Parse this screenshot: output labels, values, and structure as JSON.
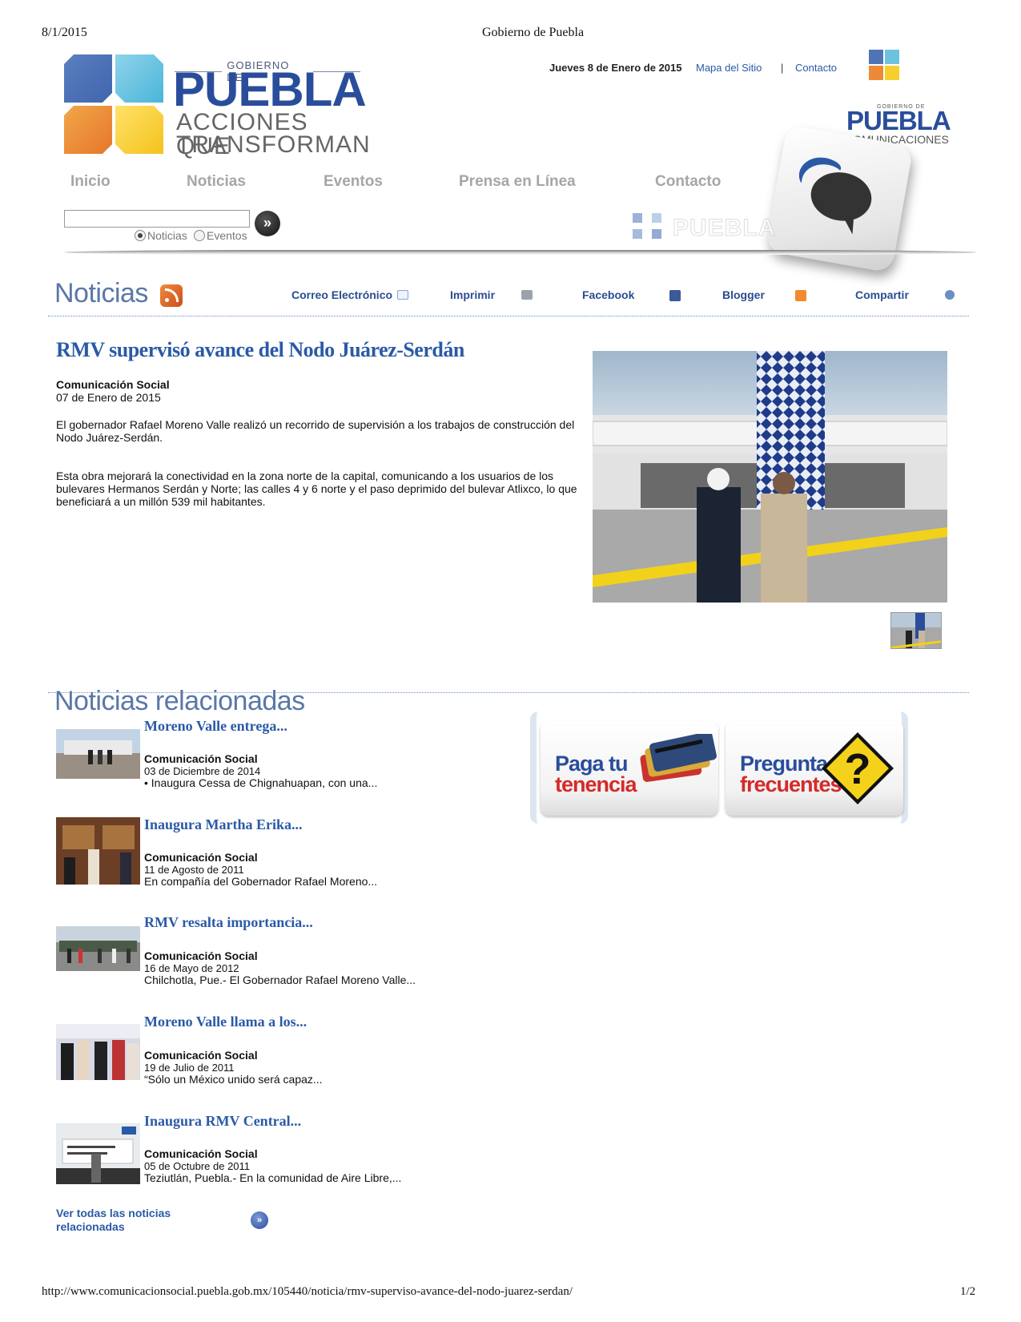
{
  "print_header": {
    "date": "8/1/2015",
    "title": "Gobierno de Puebla"
  },
  "print_footer": {
    "url": "http://www.comunicacionsocial.puebla.gob.mx/105440/noticia/rmv-superviso-avance-del-nodo-juarez-serdan/",
    "page": "1/2"
  },
  "logo": {
    "gobierno": "GOBIERNO DE",
    "puebla": "PUEBLA",
    "line1": "ACCIONES QUE",
    "line2": "TRANSFORMAN"
  },
  "top": {
    "date": "Jueves 8 de Enero de 2015",
    "sitemap": "Mapa del Sitio",
    "separator": "|",
    "contact": "Contacto"
  },
  "right_logo": {
    "gobierno": "GOBIERNO DE",
    "puebla": "PUEBLA",
    "sub": "COMUNICACIONES"
  },
  "nav": [
    "Inicio",
    "Noticias",
    "Eventos",
    "Prensa en Línea",
    "Contacto"
  ],
  "search": {
    "value": "",
    "radio_noticias": "Noticias",
    "radio_eventos": "Eventos",
    "selected": "Noticias",
    "button_glyph": "»"
  },
  "mini_logo": "PUEBLA",
  "section": {
    "title": "Noticias",
    "share": [
      "Correo Electrónico",
      "Imprimir",
      "Facebook",
      "Blogger",
      "Compartir"
    ]
  },
  "article": {
    "title": "RMV supervisó avance del Nodo Juárez-Serdán",
    "author": "Comunicación Social",
    "date": "07 de Enero de 2015",
    "para1_l1": "El gobernador Rafael Moreno Valle realizó un recorrido de supervisión a los trabajos de construcción del",
    "para1_l2": "Nodo Juárez-Serdán.",
    "para2_l1": "Esta obra mejorará la conectividad en la zona norte de la capital, comunicando a los usuarios de los",
    "para2_l2": "bulevares Hermanos Serdán y Norte; las calles 4 y 6 norte y el paso deprimido del bulevar Atlixco, lo que",
    "para2_l3": "beneficiará a un millón 539 mil habitantes."
  },
  "related": {
    "title": "Noticias relacionadas",
    "items": [
      {
        "title": "Moreno Valle entrega...",
        "author": "Comunicación Social",
        "date": "03 de Diciembre de 2014",
        "snippet": "• Inaugura Cessa de Chignahuapan, con una..."
      },
      {
        "title": "Inaugura Martha Erika...",
        "author": "Comunicación Social",
        "date": "11 de Agosto de 2011",
        "snippet": "En compañía del Gobernador Rafael Moreno..."
      },
      {
        "title": "RMV resalta importancia...",
        "author": "Comunicación Social",
        "date": "16 de Mayo de 2012",
        "snippet": "Chilchotla, Pue.- El Gobernador Rafael Moreno Valle..."
      },
      {
        "title": "Moreno Valle llama a los...",
        "author": "Comunicación Social",
        "date": "19 de Julio de 2011",
        "snippet": "“Sólo un México unido será capaz..."
      },
      {
        "title": "Inaugura RMV Central...",
        "author": "Comunicación Social",
        "date": "05 de Octubre de 2011",
        "snippet": "Teziutlán, Puebla.- En la comunidad de Aire Libre,..."
      }
    ],
    "see_all": "Ver todas las noticias relacionadas",
    "see_all_glyph": "»"
  },
  "promos": {
    "tenencia": {
      "line1": "Paga tu",
      "line2": "tenencia"
    },
    "preguntas": {
      "line1": "Preguntas",
      "line2": "frecuentes",
      "glyph": "?"
    }
  },
  "colors": {
    "brand_blue": "#2a4d9b",
    "link_blue": "#2a5aa6",
    "accent_red": "#d42a2a"
  },
  "icons": [
    "rss-icon",
    "email-icon",
    "printer-icon",
    "facebook-icon",
    "blogger-icon",
    "share-icon",
    "chat-bubbles-icon",
    "credit-cards-icon",
    "question-sign-icon"
  ]
}
